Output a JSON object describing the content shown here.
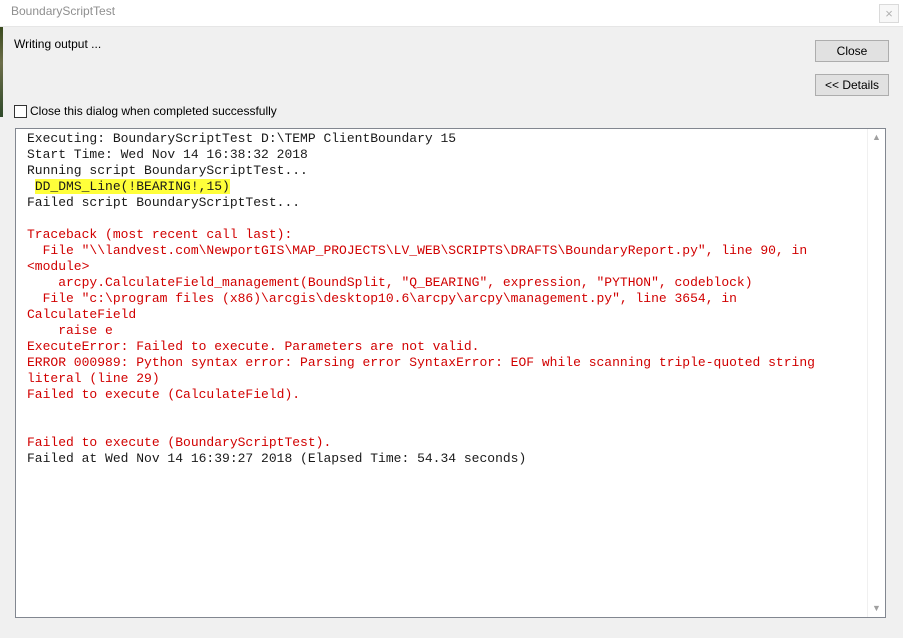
{
  "window": {
    "title": "BoundaryScriptTest",
    "close_glyph": "×"
  },
  "status": {
    "text": "Writing output ..."
  },
  "buttons": {
    "close_label": "Close",
    "details_label": "<< Details"
  },
  "option": {
    "label": "Close this dialog when completed successfully",
    "checked": false
  },
  "log": {
    "highlight_color": "#ffff3a",
    "error_color": "#d10000",
    "lines": [
      {
        "text": "Executing: BoundaryScriptTest D:\\TEMP ClientBoundary 15",
        "style": "black"
      },
      {
        "text": "Start Time: Wed Nov 14 16:38:32 2018",
        "style": "black"
      },
      {
        "text": "Running script BoundaryScriptTest...",
        "style": "black"
      },
      {
        "text": "DD_DMS_Line(!BEARING!,15)",
        "style": "highlight"
      },
      {
        "text": "Failed script BoundaryScriptTest...",
        "style": "black"
      },
      {
        "text": "",
        "style": "black"
      },
      {
        "text": "Traceback (most recent call last):",
        "style": "red"
      },
      {
        "text": "  File \"\\\\landvest.com\\NewportGIS\\MAP_PROJECTS\\LV_WEB\\SCRIPTS\\DRAFTS\\BoundaryReport.py\", line 90, in",
        "style": "red"
      },
      {
        "text": "<module>",
        "style": "red"
      },
      {
        "text": "    arcpy.CalculateField_management(BoundSplit, \"Q_BEARING\", expression, \"PYTHON\", codeblock)",
        "style": "red"
      },
      {
        "text": "  File \"c:\\program files (x86)\\arcgis\\desktop10.6\\arcpy\\arcpy\\management.py\", line 3654, in",
        "style": "red"
      },
      {
        "text": "CalculateField",
        "style": "red"
      },
      {
        "text": "    raise e",
        "style": "red"
      },
      {
        "text": "ExecuteError: Failed to execute. Parameters are not valid.",
        "style": "red"
      },
      {
        "text": "ERROR 000989: Python syntax error: Parsing error SyntaxError: EOF while scanning triple-quoted string",
        "style": "red"
      },
      {
        "text": "literal (line 29)",
        "style": "red"
      },
      {
        "text": "Failed to execute (CalculateField).",
        "style": "red"
      },
      {
        "text": "",
        "style": "red"
      },
      {
        "text": "",
        "style": "red"
      },
      {
        "text": "Failed to execute (BoundaryScriptTest).",
        "style": "red"
      },
      {
        "text": "Failed at Wed Nov 14 16:39:27 2018 (Elapsed Time: 54.34 seconds)",
        "style": "black"
      }
    ]
  },
  "scrollbar": {
    "up_icon": "chevron-up-icon",
    "down_icon": "chevron-down-icon"
  }
}
